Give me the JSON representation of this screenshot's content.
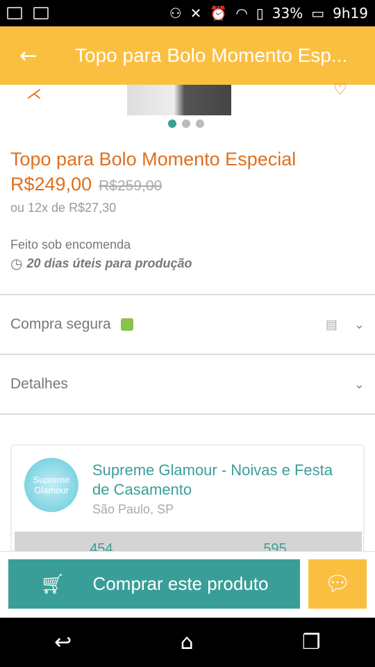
{
  "status_bar": {
    "battery": "33%",
    "time": "9h19"
  },
  "app_bar": {
    "title": "Topo para Bolo Momento Esp..."
  },
  "gallery": {
    "dot_count": 3,
    "active_index": 0
  },
  "product": {
    "title": "Topo para Bolo Momento Especial",
    "price": "R$249,00",
    "old_price": "R$259,00",
    "installments": "ou 12x de R$27,30",
    "made_to_order": "Feito sob encomenda",
    "production_time": "20 dias úteis para produção"
  },
  "sections": {
    "secure_purchase": "Compra segura",
    "details": "Detalhes"
  },
  "store": {
    "avatar_text": "Supreme Glamour",
    "name": "Supreme Glamour - Noivas  e Festa de Casamento",
    "location": "São Paulo, SP",
    "stats": [
      "454",
      "595"
    ]
  },
  "actions": {
    "buy_label": "Comprar este produto"
  }
}
